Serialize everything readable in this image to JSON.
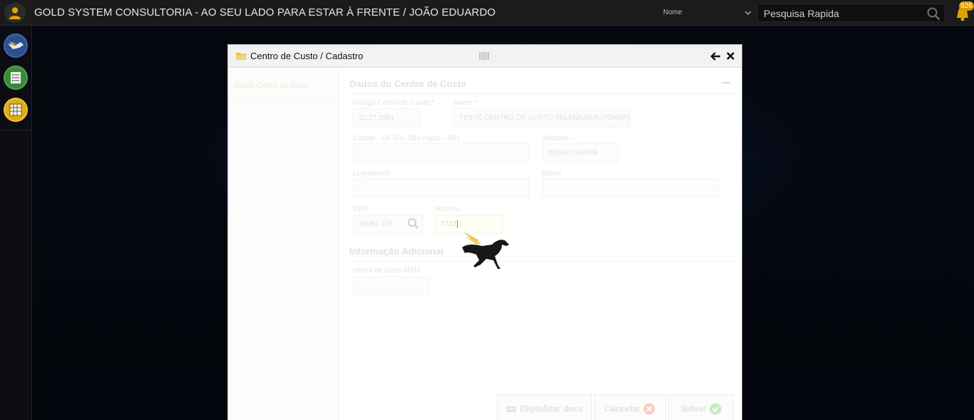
{
  "header": {
    "title": "GOLD SYSTEM CONSULTORIA - AO SEU LADO PARA ESTAR À FRENTE / JOÃO EDUARDO",
    "search_select_value": "Nome",
    "search_placeholder": "Pesquisa Rapida",
    "notification_count": "926"
  },
  "modal": {
    "title": "Centro de Custo / Cadastro",
    "left_tab": "Dados Centro de Custo",
    "section1_title": "Dados do Centro de Custo",
    "section2_title": "Informação Adicional",
    "fields": {
      "codigo": {
        "label": "Código Centro de Custo *",
        "value": "32.27.3581"
      },
      "nome": {
        "label": "Nome *",
        "value": "TESTE CENTRO DE CUSTO SELENIUM AUTOMATIZ"
      },
      "cidade": {
        "label": "Cidade - UF (Ex: São Paulo - SP)",
        "value": ""
      },
      "telefone": {
        "label": "Telefone",
        "value": "(55)0117-58708"
      },
      "logradouro": {
        "label": "Logradouro",
        "value": ""
      },
      "bairro": {
        "label": "Bairro",
        "value": ""
      },
      "cep": {
        "label": "CEP",
        "value": "15081-115"
      },
      "numero": {
        "label": "Número",
        "value": "1733"
      },
      "adicional": {
        "label": "centro de custo MXM",
        "value": ""
      }
    },
    "buttons": {
      "digitalizar": "Digitalizar docs",
      "cancelar": "Cancelar",
      "salvar": "Salvar"
    }
  },
  "colors": {
    "topbar": "#1b1b1b",
    "accent_gold": "#d89b00",
    "sidebar_icon_blue": "#2d4f8e",
    "sidebar_icon_green": "#3b8a3a",
    "sidebar_icon_yellow": "#e0ad14"
  },
  "icons": {
    "sidebar": [
      "pegasus-icon",
      "report-icon",
      "grid-icon"
    ],
    "header": [
      "user-icon",
      "chevron-down-icon",
      "search-icon",
      "bell-icon"
    ]
  }
}
